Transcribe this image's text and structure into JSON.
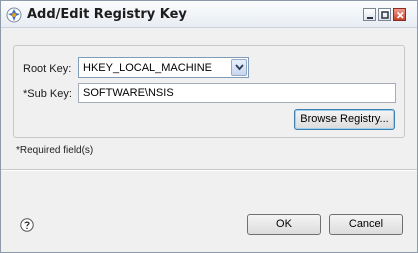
{
  "window": {
    "title": "Add/Edit Registry Key",
    "icon": "app-logo-icon",
    "controls": [
      "minimize-icon",
      "maximize-icon",
      "close-icon"
    ]
  },
  "form": {
    "root_key_label": "Root Key:",
    "root_key_value": "HKEY_LOCAL_MACHINE",
    "sub_key_label": "*Sub Key:",
    "sub_key_value": "SOFTWARE\\NSIS",
    "browse_label": "Browse Registry..."
  },
  "required_note": "*Required field(s)",
  "footer": {
    "help_icon": "help-icon",
    "ok_label": "OK",
    "cancel_label": "Cancel"
  },
  "colors": {
    "window_bg": "#f0f0f0",
    "close_button": "#c9412a",
    "focus_border": "#3c7fb1"
  }
}
